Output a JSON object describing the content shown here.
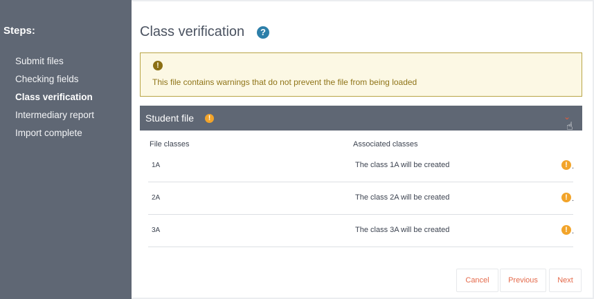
{
  "sidebar": {
    "title": "Steps:",
    "steps": [
      {
        "label": "Submit files",
        "active": false
      },
      {
        "label": "Checking fields",
        "active": false
      },
      {
        "label": "Class verification",
        "active": true
      },
      {
        "label": "Intermediary report",
        "active": false
      },
      {
        "label": "Import complete",
        "active": false
      }
    ]
  },
  "main": {
    "title": "Class verification",
    "help_icon": "?",
    "warning": {
      "icon": "!",
      "text": "This file contains warnings that do not prevent the file from being loaded"
    },
    "panel": {
      "title": "Student file",
      "warn_icon": "!",
      "chevron": "⌄",
      "columns": {
        "file": "File classes",
        "associated": "Associated classes"
      },
      "rows": [
        {
          "file_class": "1A",
          "associated": "The class 1A will be created",
          "warn_icon": "!",
          "dot": "."
        },
        {
          "file_class": "2A",
          "associated": "The class 2A will be created",
          "warn_icon": "!",
          "dot": "."
        },
        {
          "file_class": "3A",
          "associated": "The class 3A will be created",
          "warn_icon": "!",
          "dot": "."
        }
      ]
    },
    "buttons": {
      "cancel": "Cancel",
      "previous": "Previous",
      "next": "Next"
    }
  },
  "colors": {
    "sidebar_bg": "#5f6774",
    "accent_help": "#2d7fa9",
    "warning_bg": "#fcf8e4",
    "warning_icon": "#f2a42a",
    "button_text": "#e4694a"
  },
  "icons": {
    "help": "question-circle-icon",
    "warning": "exclamation-circle-icon",
    "chevron": "chevron-down-icon",
    "cursor": "hand-pointer-icon"
  }
}
